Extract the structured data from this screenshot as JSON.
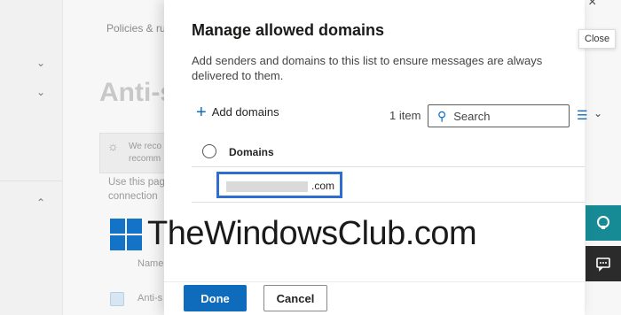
{
  "background": {
    "breadcrumb": "Policies & ru",
    "page_title": "Anti-s",
    "banner_lines": [
      "We reco",
      "recomm"
    ],
    "body_lines": [
      "Use this pag",
      "connection"
    ],
    "column_header": "Name",
    "row_label": "Anti-s"
  },
  "panel": {
    "title": "Manage allowed domains",
    "description": "Add senders and domains to this list to ensure messages are always delivered to them.",
    "add_label": "Add domains",
    "item_count": "1 item",
    "search_placeholder": "Search",
    "column_domains": "Domains",
    "row_domain_suffix": ".com",
    "done_label": "Done",
    "cancel_label": "Cancel"
  },
  "close_tooltip": "Close",
  "watermark": "TheWindowsClub.com",
  "colors": {
    "accent": "#0f6cbd",
    "highlight_border": "#2f6dd0",
    "side_teal": "#178b95"
  }
}
